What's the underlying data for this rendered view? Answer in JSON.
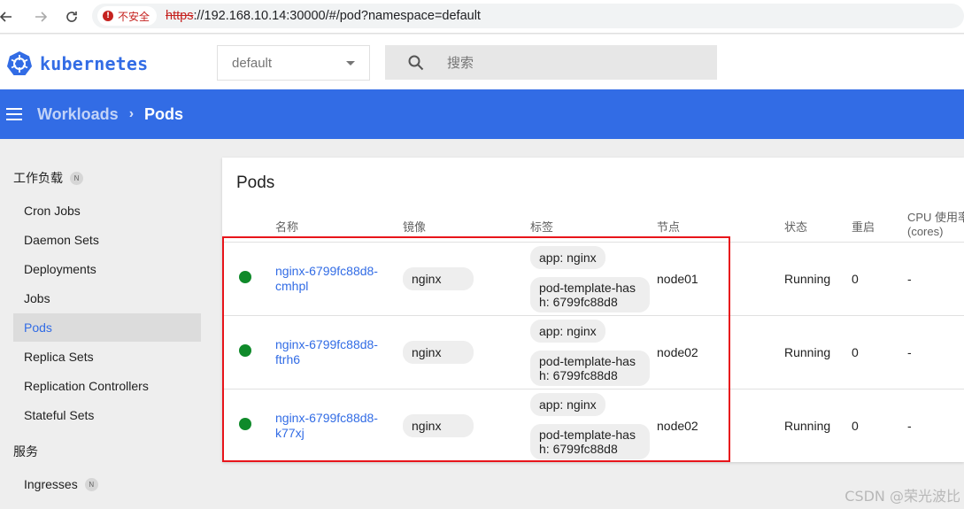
{
  "browser": {
    "insecure_label": "不安全",
    "url_scheme": "https",
    "url_rest": "://192.168.10.14:30000/#/pod?namespace=default"
  },
  "header": {
    "logo_text": "kubernetes",
    "namespace": "default",
    "search_placeholder": "搜索"
  },
  "toolbar": {
    "breadcrumb_parent": "Workloads",
    "breadcrumb_current": "Pods"
  },
  "sidebar": {
    "section_workloads": "工作负载",
    "section_badge": "N",
    "items": [
      "Cron Jobs",
      "Daemon Sets",
      "Deployments",
      "Jobs",
      "Pods",
      "Replica Sets",
      "Replication Controllers",
      "Stateful Sets"
    ],
    "section_services": "服务",
    "ingresses": "Ingresses",
    "ingresses_badge": "N"
  },
  "card": {
    "title": "Pods",
    "columns": {
      "name": "名称",
      "image": "镜像",
      "labels": "标签",
      "node": "节点",
      "status": "状态",
      "restarts": "重启",
      "cpu_line1": "CPU 使用率",
      "cpu_line2": "(cores)"
    },
    "rows": [
      {
        "name_line1": "nginx-6799fc88d8-",
        "name_line2": "cmhpl",
        "image": "nginx",
        "label1": "app: nginx",
        "label2_line1": "pod-template-has",
        "label2_line2": "h: 6799fc88d8",
        "node": "node01",
        "status": "Running",
        "restarts": "0",
        "cpu": "-"
      },
      {
        "name_line1": "nginx-6799fc88d8-",
        "name_line2": "ftrh6",
        "image": "nginx",
        "label1": "app: nginx",
        "label2_line1": "pod-template-has",
        "label2_line2": "h: 6799fc88d8",
        "node": "node02",
        "status": "Running",
        "restarts": "0",
        "cpu": "-"
      },
      {
        "name_line1": "nginx-6799fc88d8-",
        "name_line2": "k77xj",
        "image": "nginx",
        "label1": "app: nginx",
        "label2_line1": "pod-template-has",
        "label2_line2": "h: 6799fc88d8",
        "node": "node02",
        "status": "Running",
        "restarts": "0",
        "cpu": "-"
      }
    ]
  },
  "colors": {
    "brand_blue": "#326ce5",
    "running_green": "#0f8a2a",
    "highlight_red": "#e8151b"
  },
  "watermark": "CSDN @荣光波比"
}
